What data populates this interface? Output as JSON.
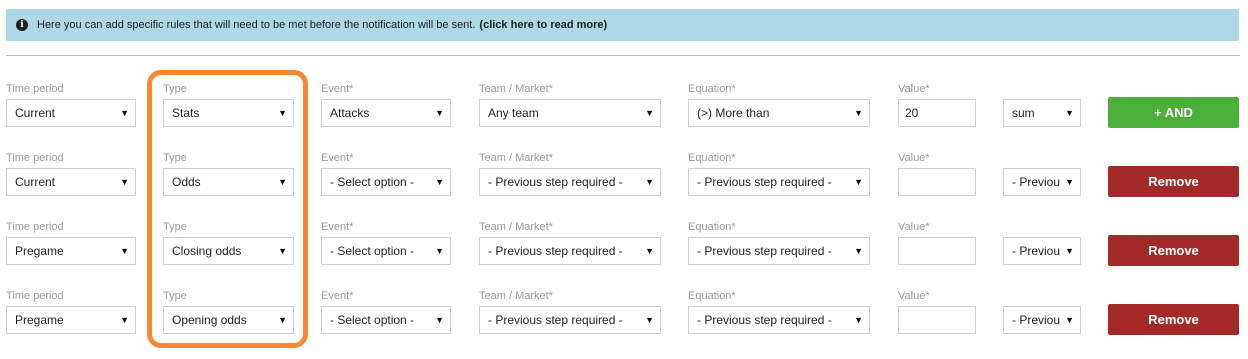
{
  "info": {
    "text": "Here you can add specific rules that will need to be met before the notification will be sent.",
    "link": "(click here to read more)"
  },
  "labels": {
    "time_period": "Time period",
    "type": "Type",
    "event": "Event*",
    "team_market": "Team / Market*",
    "equation": "Equation*",
    "value": "Value*"
  },
  "rows": [
    {
      "time_period": "Current",
      "type": "Stats",
      "event": "Attacks",
      "team_market": "Any team",
      "equation": "(>) More than",
      "value": "20",
      "aggregate": "sum",
      "button": "+ AND"
    },
    {
      "time_period": "Current",
      "type": "Odds",
      "event": "- Select option -",
      "team_market": "- Previous step required -",
      "equation": "- Previous step required -",
      "value": "",
      "aggregate": "- Previou",
      "button": "Remove"
    },
    {
      "time_period": "Pregame",
      "type": "Closing odds",
      "event": "- Select option -",
      "team_market": "- Previous step required -",
      "equation": "- Previous step required -",
      "value": "",
      "aggregate": "- Previou",
      "button": "Remove"
    },
    {
      "time_period": "Pregame",
      "type": "Opening odds",
      "event": "- Select option -",
      "team_market": "- Previous step required -",
      "equation": "- Previous step required -",
      "value": "",
      "aggregate": "- Previou",
      "button": "Remove"
    }
  ],
  "colors": {
    "info_background": "#add8e6",
    "and_button": "#4caf3a",
    "remove_button": "#a42a2a",
    "highlight": "#f7882f"
  },
  "icons": {
    "info": "info-icon",
    "caret": "caret-down-icon"
  }
}
